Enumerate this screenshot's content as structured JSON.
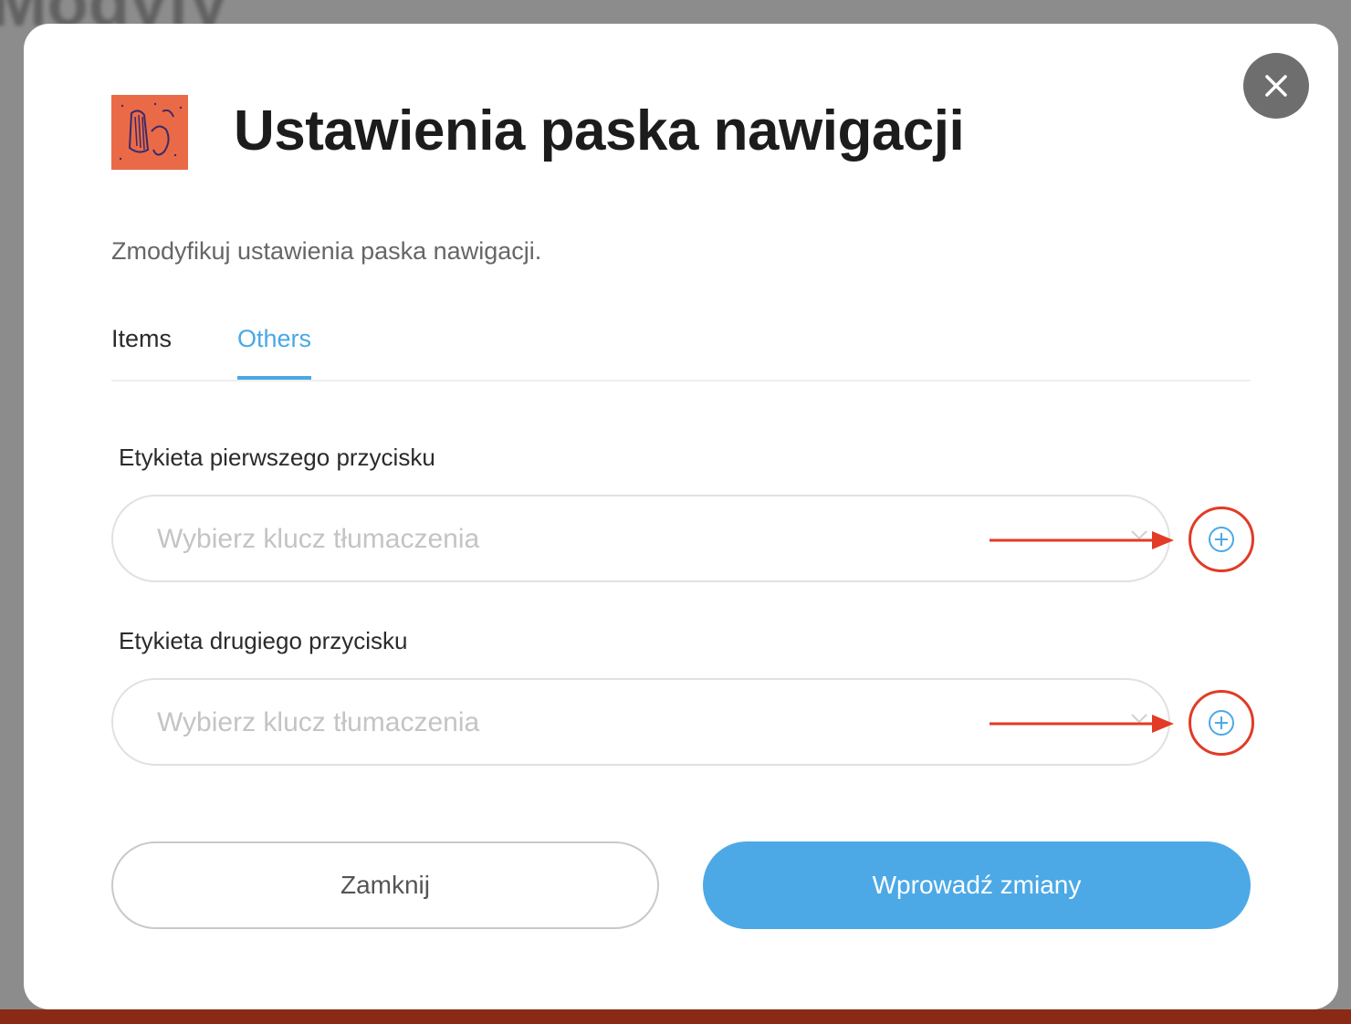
{
  "modal": {
    "title": "Ustawienia paska nawigacji",
    "subtitle": "Zmodyfikuj ustawienia paska nawigacji.",
    "logo_icon": "abstract-art-thumbnail-icon"
  },
  "tabs": [
    {
      "label": "Items",
      "active": false
    },
    {
      "label": "Others",
      "active": true
    }
  ],
  "fields": [
    {
      "label": "Etykieta pierwszego przycisku",
      "placeholder": "Wybierz klucz tłumaczenia"
    },
    {
      "label": "Etykieta drugiego przycisku",
      "placeholder": "Wybierz klucz tłumaczenia"
    }
  ],
  "buttons": {
    "close_label": "Zamknij",
    "submit_label": "Wprowadź zmiany"
  },
  "colors": {
    "accent": "#4ca9e6",
    "annotation": "#e23b26",
    "close_button_bg": "#6e6e6e"
  }
}
